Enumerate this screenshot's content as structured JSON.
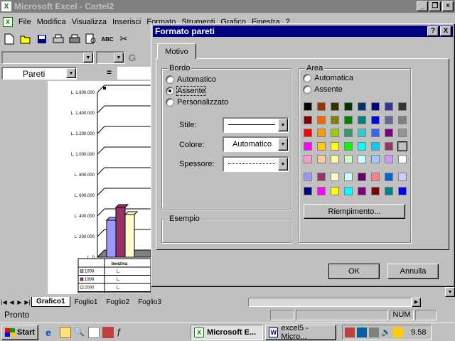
{
  "app": {
    "title": "Microsoft Excel - Cartel2",
    "menu": [
      "File",
      "Modifica",
      "Visualizza",
      "Inserisci",
      "Formato",
      "Strumenti",
      "Grafico",
      "Finestra",
      "?"
    ]
  },
  "formula": {
    "name_box": "Pareti",
    "equals": "="
  },
  "dialog": {
    "title": "Formato pareti",
    "help": "?",
    "close": "X",
    "tab": "Motivo",
    "bordo": {
      "label": "Bordo",
      "automatico": "Automatico",
      "assente": "Assente",
      "personalizzato": "Personalizzato",
      "stile": "Stile:",
      "colore": "Colore:",
      "colore_value": "Automatico",
      "spessore": "Spessore:"
    },
    "esempio": "Esempio",
    "area": {
      "label": "Area",
      "automatica": "Automatica",
      "assente": "Assente",
      "fill_button": "Riempimento...",
      "colors_main": [
        [
          "#000000",
          "#993300",
          "#333300",
          "#003300",
          "#003366",
          "#000080",
          "#333399",
          "#333333"
        ],
        [
          "#800000",
          "#ff6600",
          "#808000",
          "#008000",
          "#008080",
          "#0000ff",
          "#666699",
          "#808080"
        ],
        [
          "#ff0000",
          "#ff9900",
          "#99cc00",
          "#339966",
          "#33cccc",
          "#3366ff",
          "#800080",
          "#969696"
        ],
        [
          "#ff00ff",
          "#ffcc00",
          "#ffff00",
          "#00ff00",
          "#00ffff",
          "#00ccff",
          "#993366",
          "#c0c0c0"
        ],
        [
          "#ff99cc",
          "#ffcc99",
          "#ffff99",
          "#ccffcc",
          "#ccffff",
          "#99ccff",
          "#cc99ff",
          "#ffffff"
        ]
      ],
      "colors_extra": [
        [
          "#9999ff",
          "#993366",
          "#ffffcc",
          "#ccffff",
          "#660066",
          "#ff8080",
          "#0066cc",
          "#ccccff"
        ],
        [
          "#000080",
          "#ff00ff",
          "#ffff00",
          "#00ffff",
          "#800080",
          "#800000",
          "#008080",
          "#0000ff"
        ]
      ]
    },
    "ok": "OK",
    "cancel": "Annulla"
  },
  "chart": {
    "y_ticks": [
      "L. 1.600.000",
      "L. 1.400.000",
      "L. 1.200.000",
      "L. 1.000.000",
      "L. 800.000",
      "L. 600.000",
      "L. 400.000",
      "L. 200.000",
      "L. 0"
    ],
    "category": "benzina",
    "series": [
      "1998",
      "1999",
      "2000"
    ],
    "values_label": "L.",
    "bar_colors": [
      "#9999ff",
      "#993366",
      "#ffffcc"
    ]
  },
  "sheets": {
    "tabs": [
      "Grafico1",
      "Foglio1",
      "Foglio2",
      "Foglio3"
    ],
    "active": "Grafico1"
  },
  "status": {
    "text": "Pronto",
    "num": "NUM"
  },
  "taskbar": {
    "start": "Start",
    "tasks": [
      "Microsoft E...",
      "excel5 - Micro..."
    ],
    "clock": "9.58"
  }
}
